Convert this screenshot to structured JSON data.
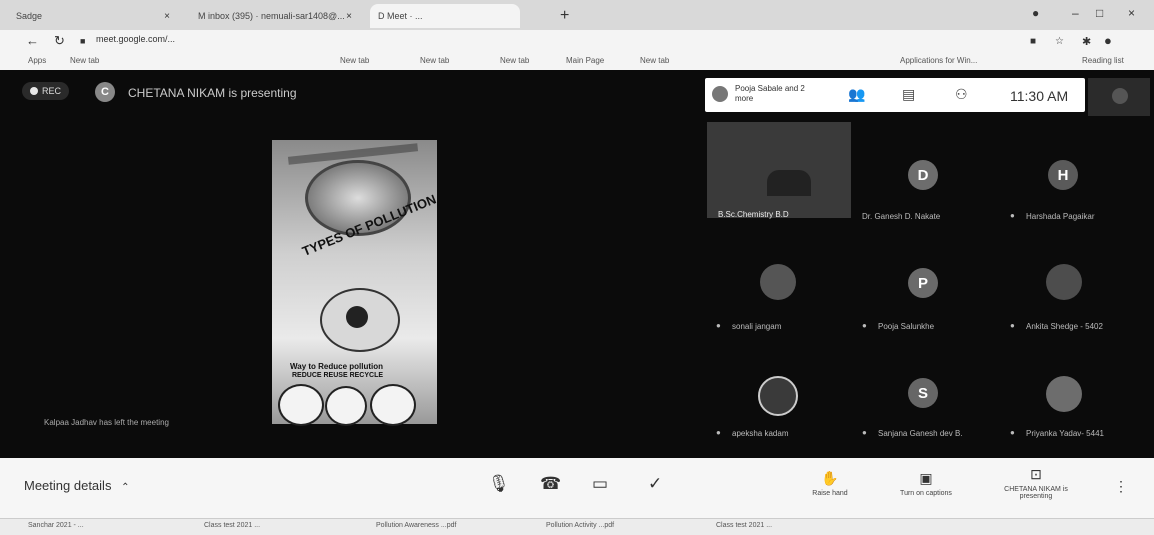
{
  "browser": {
    "tabs": [
      {
        "label": "Sadge",
        "close": "×"
      },
      {
        "label": "M  inbox (395) · nemuali-sar1408@...",
        "close": "×"
      },
      {
        "label": "D  Meet · ...",
        "close": ""
      }
    ],
    "new_tab": "+",
    "url": "meet.google.com/...",
    "bookmarks": [
      "Apps",
      "New tab",
      "New tab",
      "New tab",
      "New tab",
      "Main Page",
      "New tab",
      "Applications for Win...",
      "Reading list"
    ]
  },
  "meet": {
    "rec_label": "REC",
    "presenter_initial": "C",
    "presenter_status": "CHETANA NIKAM is presenting",
    "people_summary": "Pooja Sabale and 2 more",
    "clock": "11:30 AM",
    "left_message": "Kalpaa Jadhav has left the meeting",
    "poster": {
      "title": "TYPES OF POLLUTION",
      "subtitle": "Way to Reduce pollution",
      "slogan": "REDUCE  REUSE  RECYCLE"
    },
    "participants": [
      {
        "name": "B.Sc.Chemistry B.D",
        "type": "camera"
      },
      {
        "name": "Dr. Ganesh D. Nakate",
        "initial": "D",
        "color": "#6d6d6d"
      },
      {
        "name": "Harshada Pagaikar",
        "initial": "H",
        "color": "#5a5a5a"
      },
      {
        "name": "sonali jangam",
        "type": "photo"
      },
      {
        "name": "Pooja Salunkhe",
        "initial": "P",
        "color": "#6a6a6a"
      },
      {
        "name": "Ankita Shedge - 5402",
        "type": "photo"
      },
      {
        "name": "apeksha kadam",
        "type": "photo"
      },
      {
        "name": "Sanjana Ganesh dev B.",
        "initial": "S",
        "color": "#666666"
      },
      {
        "name": "Priyanka Yadav- 5441",
        "type": "photo"
      }
    ],
    "bottom": {
      "meeting_details": "Meeting details",
      "raise_hand": "Raise hand",
      "captions": "Turn on captions",
      "presenting": "CHETANA NIKAM is presenting"
    }
  },
  "downloads": [
    "Sanchar 2021 - ...",
    "Class test 2021 ...",
    "Pollution Awareness ...pdf",
    "Pollution Activity ...pdf",
    "Class test 2021 ..."
  ]
}
